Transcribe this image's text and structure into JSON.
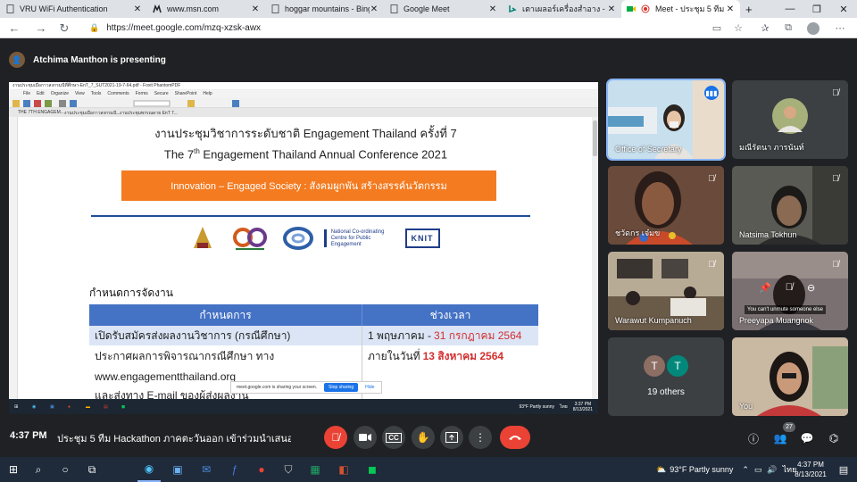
{
  "browser": {
    "tabs": [
      {
        "title": "VRU WiFi Authentication",
        "icon": "document-icon"
      },
      {
        "title": "www.msn.com",
        "icon": "msn-icon"
      },
      {
        "title": "hoggar mountains - Bing",
        "icon": "document-icon"
      },
      {
        "title": "Google Meet",
        "icon": "document-icon"
      },
      {
        "title": "เตาเผลอร์เครื่องสำอาง - Bing i",
        "icon": "bing-icon"
      },
      {
        "title": "Meet - ประชุม 5 ทีม Hac",
        "icon": "meet-icon"
      }
    ],
    "new_tab": "+",
    "url": "https://meet.google.com/mzq-xzsk-awx"
  },
  "meet": {
    "presenter_text": "Atchima Manthon is presenting",
    "time": "4:37 PM",
    "meeting_title": "ประชุม 5 ทีม Hackathon ภาคตะวันออก เข้าร่วมนำเสนอผล...",
    "participant_count": "27",
    "colors": {
      "bg": "#202124",
      "end_call": "#ea4335",
      "active_outline": "#8ab4f8"
    },
    "tiles": [
      {
        "name": "Office of Secretary",
        "state": "speaking",
        "bg": "#b9d4e6"
      },
      {
        "name": "มณีรัตนา ภารนันท์",
        "state": "muted",
        "bg": "#3c4043"
      },
      {
        "name": "ชวัดกร เจ๋มข",
        "state": "muted",
        "bg": "#7a5a45"
      },
      {
        "name": "Natsima Tokhun",
        "state": "muted",
        "bg": "#4a4a46"
      },
      {
        "name": "Warawut Kumpanuch",
        "state": "muted",
        "bg": "#8c7a62"
      },
      {
        "name": "Preeyapa Muangnok",
        "state": "muted",
        "bg": "#6d6566"
      },
      {
        "name": "19 others",
        "state": "group",
        "bg": "#3c4043"
      },
      {
        "name": "You",
        "state": "self",
        "bg": "#b9a58f"
      }
    ],
    "others_avatars": [
      "T",
      "T"
    ],
    "unmute_tooltip": "You can't unmute someone else"
  },
  "shared_pdf": {
    "window_title": "งานประชุมเมือกาวสงกรมนีที่ศึกษา-EnT_7_SUT2021-19-7-64.pdf - Foxit PhantomPDF",
    "menu": [
      "File",
      "Edit",
      "Organize",
      "View",
      "Tools",
      "Comments",
      "Forms",
      "Secure",
      "SharePoint",
      "Help"
    ],
    "tabs": [
      "THE 7TH ENGAGEM...",
      "งานประชุมเมือกาวสงกรมนี...",
      "งานประชุมพรรณดาย EnT 7..."
    ],
    "title_th": "งานประชุมวิชาการระดับชาติ Engagement Thailand ครั้งที่ 7",
    "title_en_pre": "The 7",
    "title_en_sup": "th",
    "title_en_post": " Engagement Thailand Annual Conference 2021",
    "banner": "Innovation – Engaged Society : สังคมผูกพัน สร้างสรรค์นวัตกรรม",
    "logos": [
      "emblem-logo",
      "30-years-logo",
      "spiral-logo",
      "National Co-ordinating Centre for Public Engagement",
      "KNIT"
    ],
    "schedule_heading": "กำหนดการจัดงาน",
    "table_headers": [
      "กำหนดการ",
      "ช่วงเวลา"
    ],
    "rows": [
      {
        "item": "เปิดรับสมัครส่งผลงานวิชาการ (กรณีศึกษา)",
        "time_pre": "1 พฤษภาคม - ",
        "time_red": "31 กรกฎาคม 2564"
      },
      {
        "item": "ประกาศผลการพิจารณากรณีศึกษา ทาง",
        "time_pre": "ภายในวันที่ ",
        "time_red": "13 สิงหาคม 2564"
      },
      {
        "item": "www.engagementthailand.org",
        "time_pre": "",
        "time_red": ""
      },
      {
        "item": "และส่งทาง E-mail ของผู้ส่งผลงาน",
        "time_pre": "",
        "time_red": ""
      }
    ],
    "sharing_notice": "meet.google.com is sharing your screen.",
    "stop_sharing": "Stop sharing",
    "hide": "Hide",
    "inner_weather": "93°F Partly sunny",
    "inner_time": "3:37 PM",
    "inner_date": "8/13/2021",
    "inner_lang": "ไทย"
  },
  "taskbar": {
    "weather": "93°F  Partly sunny",
    "lang": "ไทย",
    "time": "4:37 PM",
    "date": "8/13/2021"
  }
}
